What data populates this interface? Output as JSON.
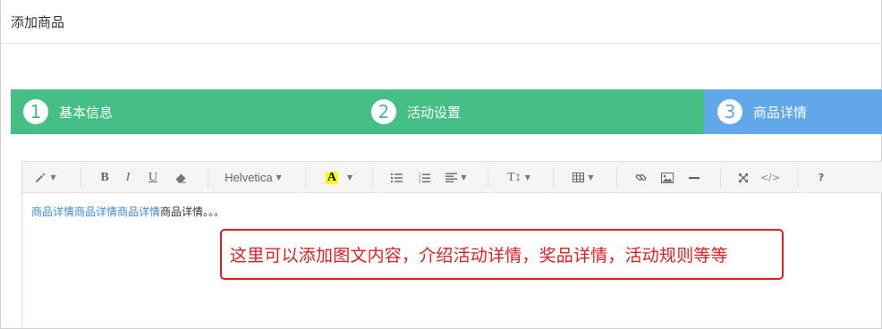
{
  "page": {
    "title": "添加商品"
  },
  "steps": [
    {
      "number": "1",
      "label": "基本信息"
    },
    {
      "number": "2",
      "label": "活动设置"
    },
    {
      "number": "3",
      "label": "商品详情"
    }
  ],
  "colors": {
    "step_done": "#46bf87",
    "step_active": "#62a7ea",
    "annotation": "#e02020",
    "link": "#3a89d6"
  },
  "toolbar": {
    "bold": "B",
    "italic": "I",
    "underline": "U",
    "font_name": "Helvetica",
    "highlight": "A",
    "font_size": "T↕",
    "help": "?",
    "code_view": "</>",
    "icons": [
      "magic-wand",
      "bold",
      "italic",
      "underline",
      "eraser",
      "font-family",
      "highlight-color",
      "unordered-list",
      "ordered-list",
      "align",
      "font-size",
      "table",
      "link",
      "picture",
      "horizontal-rule",
      "fullscreen",
      "code-view",
      "help"
    ]
  },
  "editor": {
    "linked_text": "商品详情商品详情商品详情",
    "plain_text": "商品详情。。。"
  },
  "annotation": {
    "text": "这里可以添加图文内容，介绍活动详情，奖品详情，活动规则等等"
  }
}
